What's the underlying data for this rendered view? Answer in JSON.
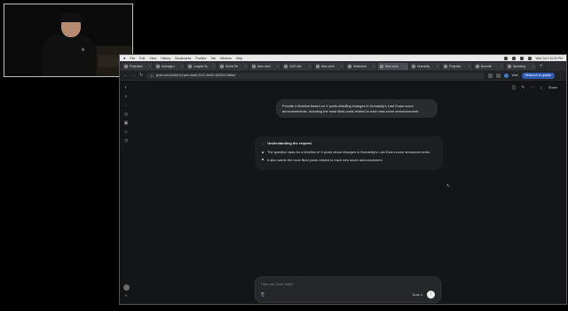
{
  "menubar": {
    "app_name": "Chrome",
    "items": [
      "File",
      "Edit",
      "View",
      "History",
      "Bookmarks",
      "Profiles",
      "Tab",
      "Window",
      "Help"
    ],
    "clock": "Wed Jul 9 10:33 PM"
  },
  "tabs": [
    {
      "label": "Projection"
    },
    {
      "label": "Average c"
    },
    {
      "label": "Largest Su"
    },
    {
      "label": "World Ge"
    },
    {
      "label": "New conv"
    },
    {
      "label": "GOD-Mo"
    },
    {
      "label": "New conv"
    },
    {
      "label": "Mastodon"
    },
    {
      "label": "New conv"
    },
    {
      "label": "Humanity"
    },
    {
      "label": "Projectio"
    },
    {
      "label": "Boundin"
    },
    {
      "label": "Speaking"
    }
  ],
  "address": {
    "url": "grok.com/chat/b1c1ae4-dad8-4310-8e65-4833011386a4",
    "wait_label": "Wait",
    "relaunch_label": "Relaunch to update"
  },
  "header": {
    "share_label": "Share"
  },
  "conversation": {
    "user_message": "Provide a timeline based on X posts detailing changes in Humanity's Last Exam score announcements, including the most liked posts related to each new score announcement.",
    "thinking_title": "Understanding the request",
    "thinking_points": [
      "The question asks for a timeline of X posts about changes in Humanity's Last Exam score announcements.",
      "It also wants the most liked posts related to each new score announcement."
    ]
  },
  "composer": {
    "placeholder": "How can Grok help?",
    "model_label": "Grok 4"
  }
}
